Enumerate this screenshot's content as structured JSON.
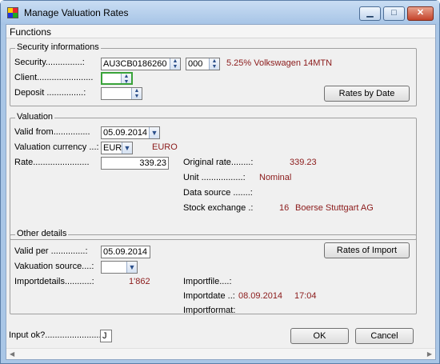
{
  "window": {
    "title": "Manage Valuation Rates"
  },
  "menu": {
    "functions": "Functions"
  },
  "security_info": {
    "legend": "Security informations",
    "security_label": "Security...............:",
    "security_value": "AU3CB0186260",
    "security_code": "000",
    "security_desc": "5.25% Volkswagen 14MTN",
    "client_label": "Client.......................",
    "client_value": "",
    "deposit_label": "Deposit ...............:",
    "deposit_value": "",
    "rates_by_date_label": "Rates by Date"
  },
  "valuation": {
    "legend": "Valuation",
    "valid_from_label": "Valid from...............",
    "valid_from_value": "05.09.2014",
    "currency_label": "Valuation currency ...:",
    "currency_value": "EUR",
    "currency_name": "EURO",
    "rate_label": "Rate.......................",
    "rate_value": "339.23",
    "original_rate_label": "Original rate........:",
    "original_rate_value": "339.23",
    "unit_label": "Unit .................:",
    "unit_value": "Nominal",
    "data_source_label": "Data source .......:",
    "data_source_value": "",
    "stock_exchange_label": "Stock exchange .:",
    "stock_exchange_code": "16",
    "stock_exchange_name": "Boerse Stuttgart AG"
  },
  "other": {
    "legend": "Other details",
    "valid_per_label": "Valid per ..............:",
    "valid_per_value": "05.09.2014",
    "source_label": "Vakuation source....:",
    "source_value": "",
    "importdetails_label": "Importdetails...........:",
    "importdetails_value": "1'862",
    "importfile_label": "Importfile....:",
    "importdate_label": "Importdate ..:",
    "importdate_date": "08.09.2014",
    "importdate_time": "17:04",
    "importformat_label": "Importformat:",
    "rates_of_import_label": "Rates of  Import"
  },
  "footer": {
    "input_ok_label": "Input ok?.......................",
    "input_ok_value": "J",
    "ok_label": "OK",
    "cancel_label": "Cancel"
  },
  "colors": {
    "accent_text": "#8b1a1a",
    "focus": "#3aa33a"
  }
}
